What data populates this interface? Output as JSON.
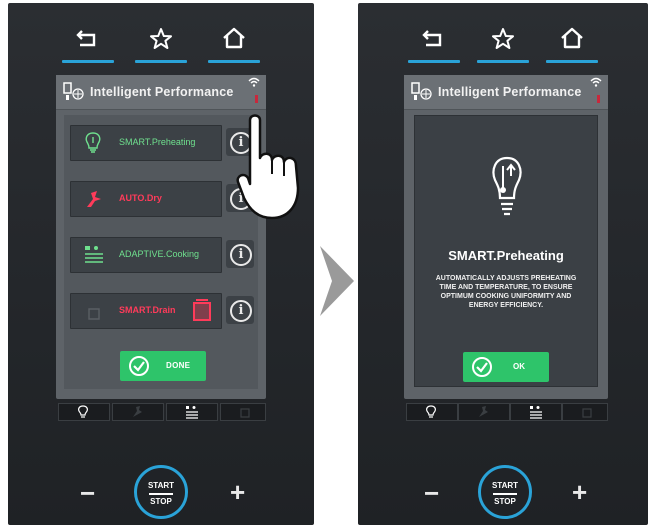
{
  "left_screen": {
    "header_title": "Intelligent Performance",
    "rows": [
      {
        "label": "SMART.Preheating",
        "style": "green",
        "icon": "bulb-thermometer-icon"
      },
      {
        "label": "AUTO.Dry",
        "style": "red",
        "icon": "fan-icon"
      },
      {
        "label": "ADAPTIVE.Cooking",
        "style": "green",
        "icon": "adaptive-cooking-icon"
      },
      {
        "label": "SMART.Drain",
        "style": "red",
        "icon": "drain-icon"
      }
    ],
    "info_glyph": "i",
    "done_label": "DONE"
  },
  "right_screen": {
    "header_title": "Intelligent Performance",
    "dialog_title": "SMART.Preheating",
    "dialog_description": "AUTOMATICALLY ADJUSTS PREHEATING TIME AND TEMPERATURE, TO ENSURE OPTIMUM COOKING UNIFORMITY AND ENERGY EFFICIENCY.",
    "ok_label": "OK"
  },
  "controls": {
    "minus": "−",
    "plus": "+",
    "start": "START",
    "stop": "STOP"
  },
  "colors": {
    "accent_blue": "#2aa3d8",
    "green_label": "#6fe08e",
    "red_label": "#ff3b5a",
    "button_green": "#2ec46a"
  }
}
